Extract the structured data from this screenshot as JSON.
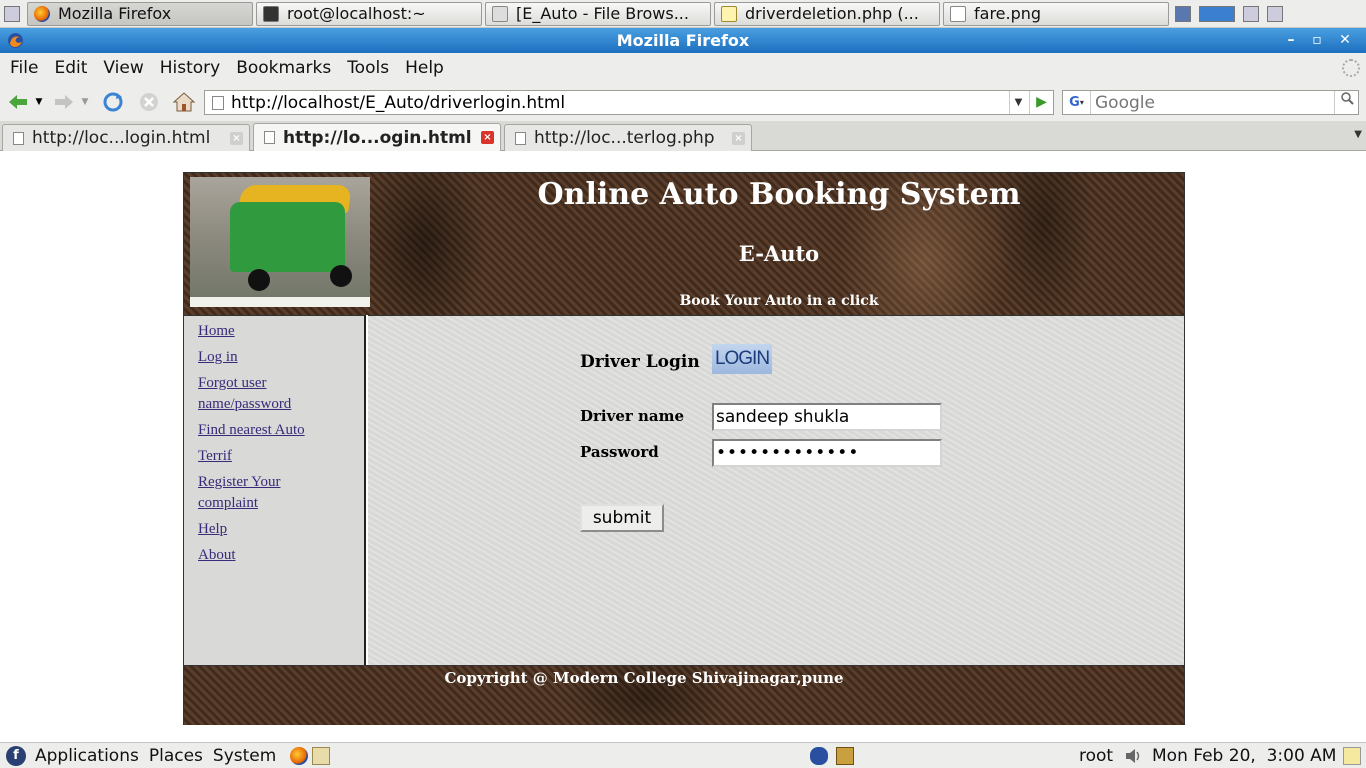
{
  "taskbar": {
    "windows": [
      {
        "label": "Mozilla Firefox",
        "icon": "firefox-icon"
      },
      {
        "label": "root@localhost:~",
        "icon": "terminal-icon"
      },
      {
        "label": "[E_Auto - File Brows...",
        "icon": "folder-icon"
      },
      {
        "label": "driverdeletion.php (...",
        "icon": "text-editor-icon"
      },
      {
        "label": "fare.png",
        "icon": "image-file-icon"
      }
    ]
  },
  "window": {
    "title": "Mozilla Firefox"
  },
  "menu": [
    "File",
    "Edit",
    "View",
    "History",
    "Bookmarks",
    "Tools",
    "Help"
  ],
  "nav": {
    "url": "http://localhost/E_Auto/driverlogin.html",
    "search_placeholder": "Google",
    "search_engine": "G"
  },
  "tabs": [
    {
      "label": "http://loc...login.html",
      "selected": false
    },
    {
      "label": "http://lo...ogin.html",
      "selected": true
    },
    {
      "label": "http://loc...terlog.php",
      "selected": false
    }
  ],
  "site": {
    "title": "Online Auto Booking System",
    "subtitle": "E-Auto",
    "tagline": "Book Your Auto in a click",
    "sidebar_links": [
      "Home",
      "Log in",
      "Forgot user name/password",
      "Find nearest Auto",
      "Terrif",
      "Register Your complaint",
      "Help",
      "About"
    ],
    "login": {
      "heading": "Driver Login",
      "badge": "LOGIN",
      "name_label": "Driver name",
      "name_value": "sandeep shukla",
      "password_label": "Password",
      "password_value": "•••••••••••••",
      "submit": "submit"
    },
    "footer": "Copyright @ Modern College Shivajinagar,pune"
  },
  "panel": {
    "menus": [
      "Applications",
      "Places",
      "System"
    ],
    "user": "root",
    "clock": "Mon Feb 20,  3:00 AM"
  },
  "colors": {
    "titlebar": "#1d6fbf",
    "banner": "#4b3323",
    "link": "#3a2a7a"
  }
}
